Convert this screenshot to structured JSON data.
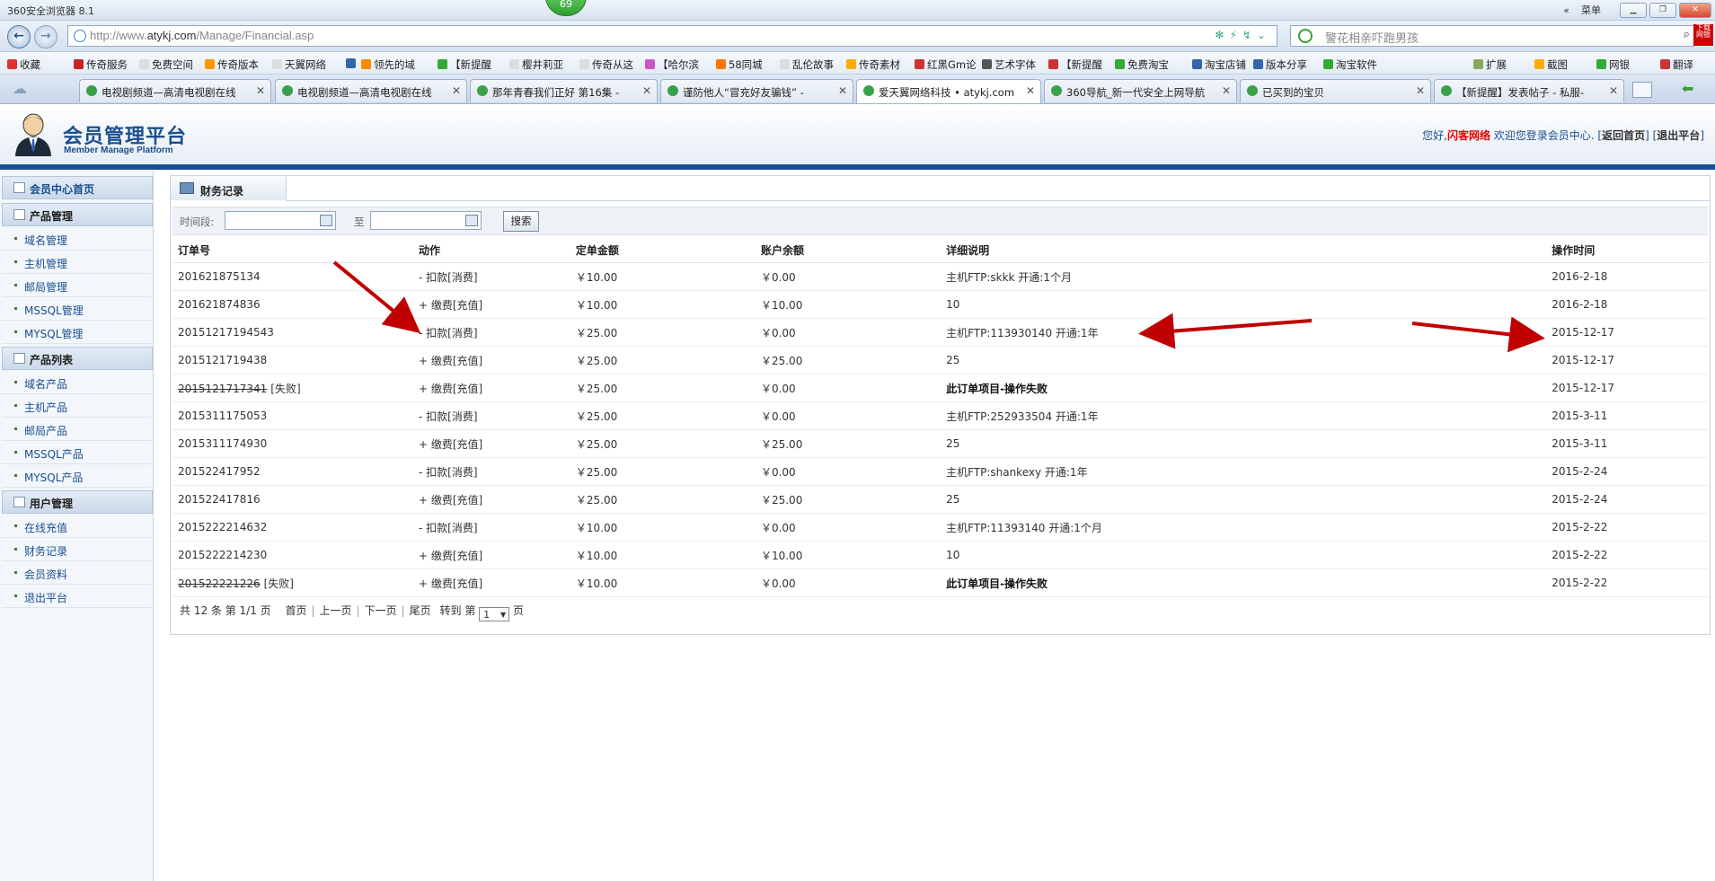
{
  "browser": {
    "title": "360安全浏览器 8.1",
    "badge": "69",
    "menu_label": "菜单",
    "url_prefix": "http://www.",
    "url_domain": "atykj.com",
    "url_path": "/Manage/Financial.asp",
    "search_placeholder": "警花相亲吓跑男孩",
    "bookmarks": [
      "收藏",
      "传奇服务",
      "免费空间",
      "传奇版本",
      "天翼网络",
      "",
      "领先的域",
      "【新提醒",
      "樱井莉亚",
      "传奇从这",
      "【哈尔滨",
      "58同城",
      "乱伦故事",
      "传奇素材",
      "红黑Gm论",
      "艺术字体",
      "【新提醒",
      "免费淘宝",
      "淘宝店铺",
      "版本分享",
      "淘宝软件",
      "扩展",
      "截图",
      "网银",
      "翻译"
    ],
    "tabs": [
      {
        "label": "电视剧频道—高清电视剧在线",
        "active": false
      },
      {
        "label": "电视剧频道—高清电视剧在线",
        "active": false
      },
      {
        "label": "那年青春我们正好  第16集 - ",
        "active": false
      },
      {
        "label": "谨防他人“冒充好友骗钱” - ",
        "active": false
      },
      {
        "label": "爱天翼网络科技 • atykj.com",
        "active": true
      },
      {
        "label": "360导航_新一代安全上网导航",
        "active": false
      },
      {
        "label": "已买到的宝贝",
        "active": false
      },
      {
        "label": "【新提醒】发表帖子 - 私服-",
        "active": false
      }
    ]
  },
  "site": {
    "brand": "会员管理平台",
    "brand_sub": "Member Manage Platform",
    "welcome_hello": "您好,",
    "welcome_user": "闪客网络",
    "welcome_text": " 欢迎您登录会员中心. [",
    "link_home": "返回首页",
    "welcome_mid": "] [",
    "link_logout": "退出平台",
    "welcome_end": "]"
  },
  "sidebar": {
    "home": "会员中心首页",
    "groups": [
      {
        "title": "产品管理",
        "items": [
          "域名管理",
          "主机管理",
          "邮局管理",
          "MSSQL管理",
          "MYSQL管理"
        ]
      },
      {
        "title": "产品列表",
        "items": [
          "域名产品",
          "主机产品",
          "邮局产品",
          "MSSQL产品",
          "MYSQL产品"
        ]
      },
      {
        "title": "用户管理",
        "items": [
          "在线充值",
          "财务记录",
          "会员资料",
          "退出平台"
        ]
      }
    ]
  },
  "main": {
    "tab_title": "财务记录",
    "filter_label": "时间段:",
    "filter_to": "至",
    "search_button": "搜索",
    "columns": [
      "订单号",
      "动作",
      "定单金额",
      "账户余额",
      "详细说明",
      "操作时间"
    ],
    "rows": [
      {
        "order": "201621875134",
        "failed": false,
        "action": "- 扣款[消费]",
        "amount": "￥10.00",
        "balance": "￥0.00",
        "detail": "主机FTP:skkk 开通:1个月",
        "detail_bold": false,
        "time": "2016-2-18"
      },
      {
        "order": "201621874836",
        "failed": false,
        "action": "+ 缴费[充值]",
        "amount": "￥10.00",
        "balance": "￥10.00",
        "detail": "10",
        "detail_bold": false,
        "time": "2016-2-18"
      },
      {
        "order": "20151217194543",
        "failed": false,
        "action": "- 扣款[消费]",
        "amount": "￥25.00",
        "balance": "￥0.00",
        "detail": "主机FTP:113930140 开通:1年",
        "detail_bold": false,
        "time": "2015-12-17"
      },
      {
        "order": "2015121719438",
        "failed": false,
        "action": "+ 缴费[充值]",
        "amount": "￥25.00",
        "balance": "￥25.00",
        "detail": "25",
        "detail_bold": false,
        "time": "2015-12-17"
      },
      {
        "order": "2015121717341",
        "failed": true,
        "action": "+ 缴费[充值]",
        "amount": "￥25.00",
        "balance": "￥0.00",
        "detail": "此订单项目-操作失败",
        "detail_bold": true,
        "time": "2015-12-17"
      },
      {
        "order": "2015311175053",
        "failed": false,
        "action": "- 扣款[消费]",
        "amount": "￥25.00",
        "balance": "￥0.00",
        "detail": "主机FTP:252933504 开通:1年",
        "detail_bold": false,
        "time": "2015-3-11"
      },
      {
        "order": "2015311174930",
        "failed": false,
        "action": "+ 缴费[充值]",
        "amount": "￥25.00",
        "balance": "￥25.00",
        "detail": "25",
        "detail_bold": false,
        "time": "2015-3-11"
      },
      {
        "order": "201522417952",
        "failed": false,
        "action": "- 扣款[消费]",
        "amount": "￥25.00",
        "balance": "￥0.00",
        "detail": "主机FTP:shankexy 开通:1年",
        "detail_bold": false,
        "time": "2015-2-24"
      },
      {
        "order": "201522417816",
        "failed": false,
        "action": "+ 缴费[充值]",
        "amount": "￥25.00",
        "balance": "￥25.00",
        "detail": "25",
        "detail_bold": false,
        "time": "2015-2-24"
      },
      {
        "order": "2015222214632",
        "failed": false,
        "action": "- 扣款[消费]",
        "amount": "￥10.00",
        "balance": "￥0.00",
        "detail": "主机FTP:11393140 开通:1个月",
        "detail_bold": false,
        "time": "2015-2-22"
      },
      {
        "order": "2015222214230",
        "failed": false,
        "action": "+ 缴费[充值]",
        "amount": "￥10.00",
        "balance": "￥10.00",
        "detail": "10",
        "detail_bold": false,
        "time": "2015-2-22"
      },
      {
        "order": "201522221226",
        "failed": true,
        "action": "+ 缴费[充值]",
        "amount": "￥10.00",
        "balance": "￥0.00",
        "detail": "此订单项目-操作失败",
        "detail_bold": true,
        "time": "2015-2-22"
      }
    ],
    "failed_tag": "[失败]",
    "pager": {
      "summary": "共 12 条 第 1/1 页",
      "first": "首页",
      "prev": "上一页",
      "next": "下一页",
      "last": "尾页",
      "goto": "转到 第",
      "page": "1",
      "page_suffix": "页"
    }
  },
  "colors": {
    "accent": "#1a4f8f",
    "arrow": "#c00000",
    "highlight": "#e00000"
  }
}
